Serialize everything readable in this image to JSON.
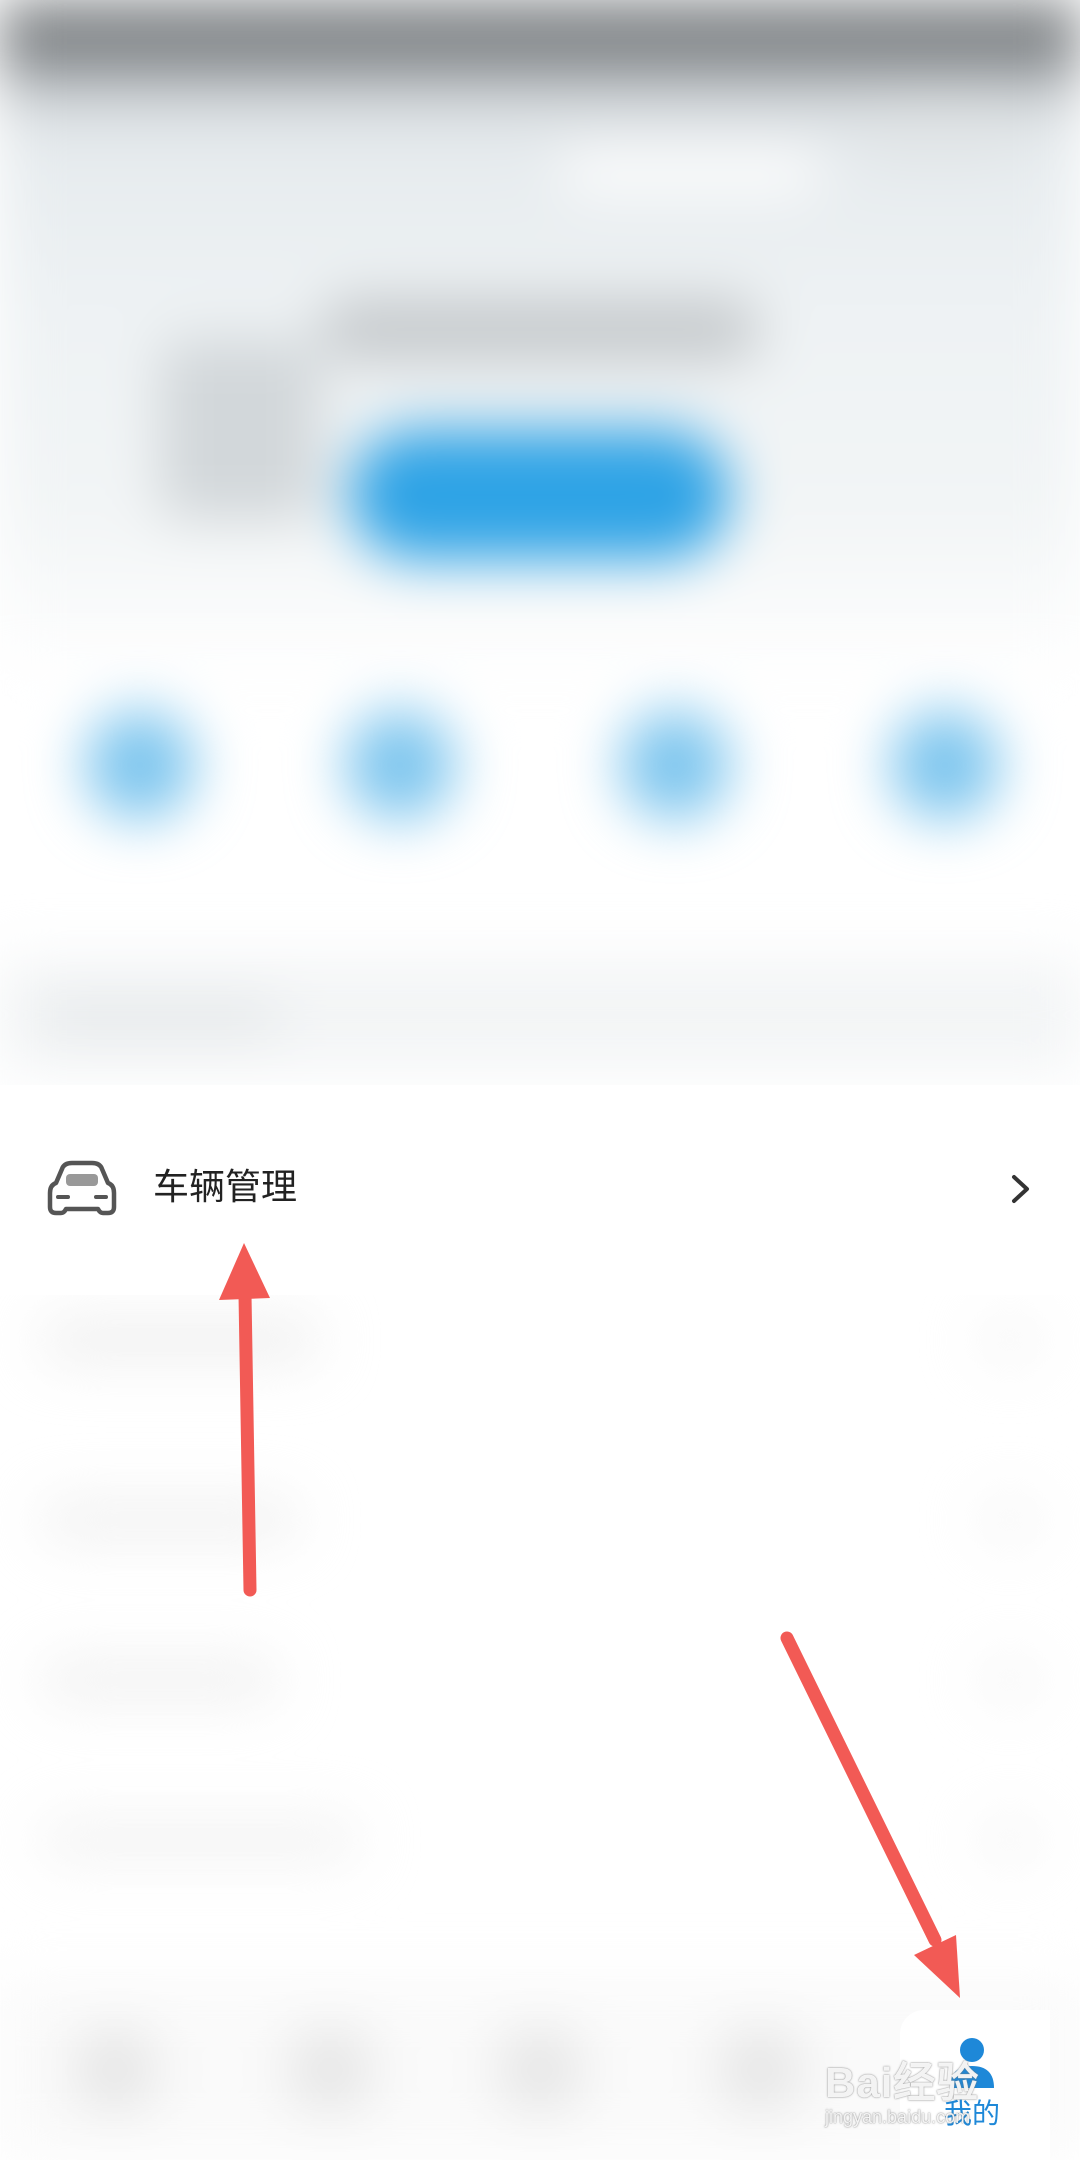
{
  "vehicle_management": {
    "label": "车辆管理",
    "icon": "car-icon",
    "chevron": "chevron-right-icon"
  },
  "bottom_nav": {
    "mine_tab": {
      "label": "我的",
      "icon": "person-icon",
      "color": "#1e88d8"
    }
  },
  "watermark": {
    "brand": "Bai经验",
    "domain": "jingyan.baidu.com"
  },
  "annotations": {
    "arrow_color": "#f25a55"
  }
}
